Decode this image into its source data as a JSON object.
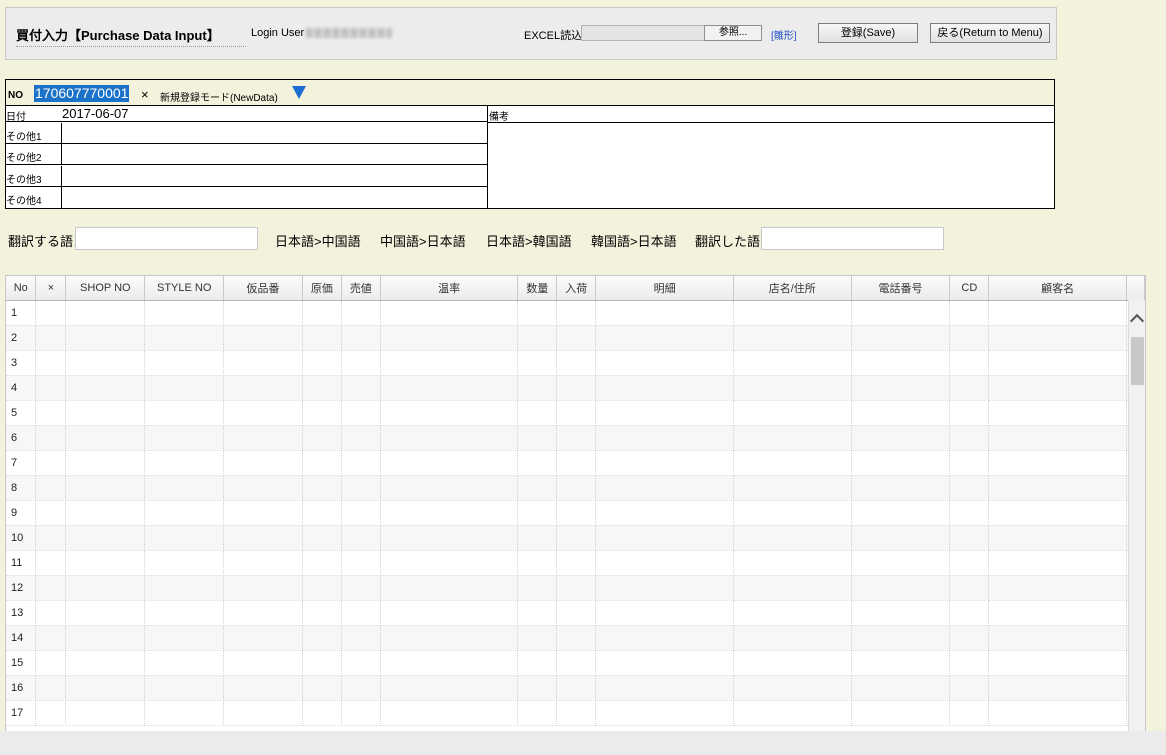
{
  "header": {
    "title": "買付入力【Purchase Data Input】",
    "login_label": "Login User",
    "excel_label": "EXCEL読込",
    "browse_label": "参照...",
    "template_link": "[雛形]",
    "save_label": "登録(Save)",
    "menu_label": "戻る(Return to Menu)"
  },
  "form": {
    "no_label": "NO",
    "no_value": "170607770001",
    "clear_x": "×",
    "mode_label": "新規登録モード(NewData)",
    "date_label": "日付",
    "date_value": "2017-06-07",
    "remarks_label": "備考",
    "other_labels": [
      "その他1",
      "その他2",
      "その他3",
      "その他4"
    ]
  },
  "translation": {
    "source_label": "翻訳する語",
    "options": [
      "日本語>中国語",
      "中国語>日本語",
      "日本語>韓国語",
      "韓国語>日本語"
    ],
    "result_label": "翻訳した語"
  },
  "grid": {
    "columns": [
      "No",
      "×",
      "SHOP NO",
      "STYLE NO",
      "仮品番",
      "原価",
      "売値",
      "温率",
      "数量",
      "入荷",
      "明細",
      "店名/住所",
      "電話番号",
      "CD",
      "顧客名"
    ],
    "rows": [
      "1",
      "2",
      "3",
      "4",
      "5",
      "6",
      "7",
      "8",
      "9",
      "10",
      "11",
      "12",
      "13",
      "14",
      "15",
      "16",
      "17"
    ]
  }
}
